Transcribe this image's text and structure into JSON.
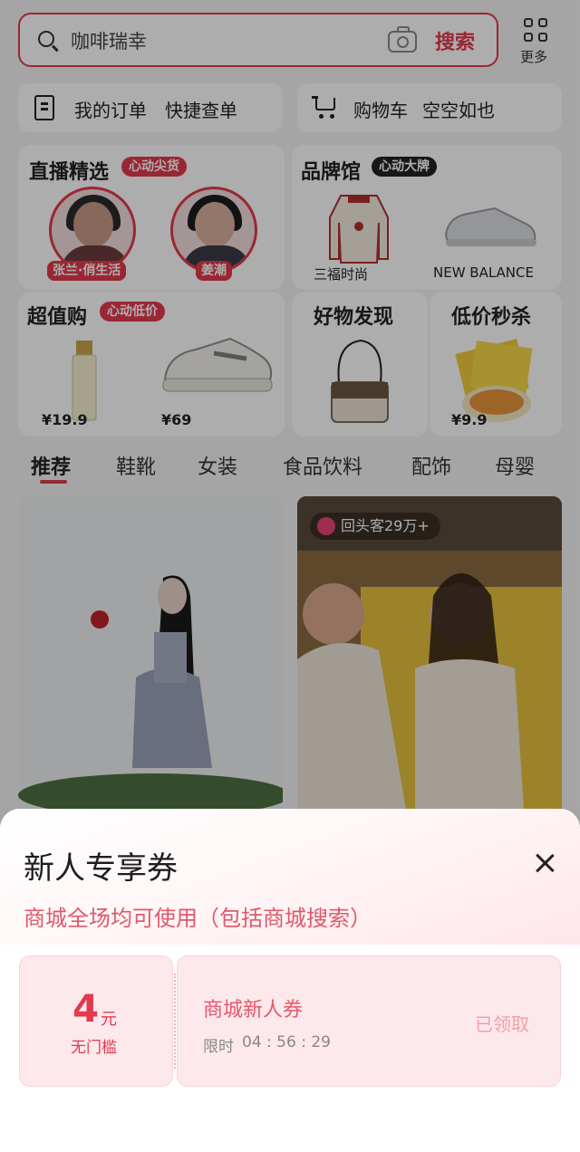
{
  "search": {
    "query": "咖啡瑞幸",
    "button_label": "搜索",
    "more_label": "更多"
  },
  "quick": {
    "orders": {
      "label": "我的订单",
      "sub": "快捷查单"
    },
    "cart": {
      "label": "购物车",
      "sub": "空空如也"
    }
  },
  "live": {
    "title": "直播精选",
    "tag": "心动尖货",
    "streamers": [
      {
        "name": "张兰·俏生活"
      },
      {
        "name": "姜潮"
      }
    ]
  },
  "brand": {
    "title": "品牌馆",
    "tag": "心动大牌",
    "items": [
      {
        "label": "三福时尚"
      },
      {
        "label": "NEW BALANCE"
      }
    ]
  },
  "value_buy": {
    "title": "超值购",
    "tag": "心动低价",
    "items": [
      {
        "price": "¥19.9"
      },
      {
        "price": "¥69"
      }
    ]
  },
  "discover": {
    "title": "好物发现"
  },
  "flash_sale": {
    "title": "低价秒杀",
    "items": [
      {
        "price": "¥9.9"
      }
    ]
  },
  "tabs": [
    {
      "label": "推荐"
    },
    {
      "label": "鞋靴"
    },
    {
      "label": "女装"
    },
    {
      "label": "食品饮料"
    },
    {
      "label": "配饰"
    },
    {
      "label": "母婴"
    }
  ],
  "feed": {
    "badge": "回头客29万+"
  },
  "coupon_sheet": {
    "title": "新人专享券",
    "subtitle": "商城全场均可使用（包括商城搜索）",
    "coupon": {
      "amount": "4",
      "unit": "元",
      "threshold": "无门槛",
      "name": "商城新人券",
      "timer_label": "限时",
      "timer_value": "04 : 56 : 29",
      "status": "已领取"
    }
  },
  "colors": {
    "accent": "#e23a4c",
    "sheet_pink": "#fde8ec"
  }
}
